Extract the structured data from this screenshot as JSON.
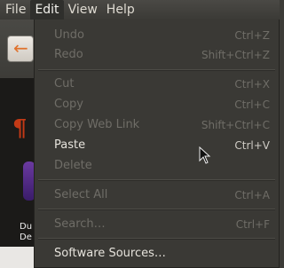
{
  "menubar": {
    "items": [
      {
        "label": "File"
      },
      {
        "label": "Edit"
      },
      {
        "label": "View"
      },
      {
        "label": "Help"
      }
    ]
  },
  "background": {
    "caption_line1": "Du",
    "caption_line2": "De"
  },
  "edit_menu": {
    "items": [
      {
        "label": "Undo",
        "accel": "Ctrl+Z",
        "enabled": false
      },
      {
        "label": "Redo",
        "accel": "Shift+Ctrl+Z",
        "enabled": false
      },
      {
        "label": "Cut",
        "accel": "Ctrl+X",
        "enabled": false
      },
      {
        "label": "Copy",
        "accel": "Ctrl+C",
        "enabled": false
      },
      {
        "label": "Copy Web Link",
        "accel": "Shift+Ctrl+C",
        "enabled": false
      },
      {
        "label": "Paste",
        "accel": "Ctrl+V",
        "enabled": true
      },
      {
        "label": "Delete",
        "accel": "",
        "enabled": false
      },
      {
        "label": "Select All",
        "accel": "Ctrl+A",
        "enabled": false
      },
      {
        "label": "Search…",
        "accel": "Ctrl+F",
        "enabled": false
      },
      {
        "label": "Software Sources…",
        "accel": "",
        "enabled": true
      }
    ]
  },
  "colors": {
    "menu_bg": "#3a3935",
    "enabled_text": "#e6e3dc",
    "disabled_text": "#6f6d67"
  }
}
